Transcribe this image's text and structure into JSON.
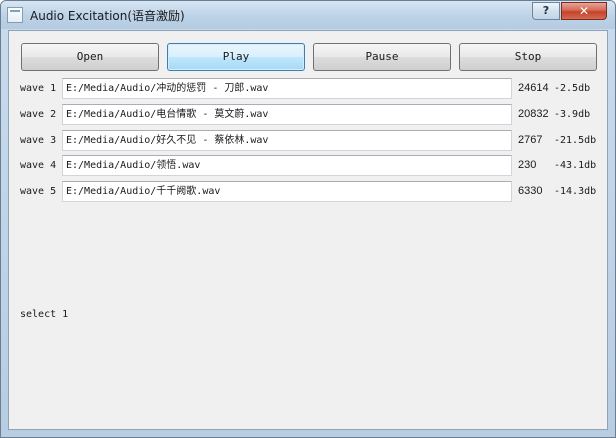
{
  "window": {
    "title": "Audio Excitation(语音激励)",
    "help_label": "?",
    "close_label": "✕"
  },
  "toolbar": {
    "open_label": "Open",
    "play_label": "Play",
    "pause_label": "Pause",
    "stop_label": "Stop"
  },
  "waves": [
    {
      "label": "wave 1",
      "path": "E:/Media/Audio/冲动的惩罚 - 刀郎.wav",
      "value": "24614",
      "db": "-2.5db"
    },
    {
      "label": "wave 2",
      "path": "E:/Media/Audio/电台情歌 - 莫文蔚.wav",
      "value": "20832",
      "db": "-3.9db"
    },
    {
      "label": "wave 3",
      "path": "E:/Media/Audio/好久不见 - 蔡依林.wav",
      "value": "2767",
      "db": "-21.5db"
    },
    {
      "label": "wave 4",
      "path": "E:/Media/Audio/领悟.wav",
      "value": "230",
      "db": "-43.1db"
    },
    {
      "label": "wave 5",
      "path": "E:/Media/Audio/千千阙歌.wav",
      "value": "6330",
      "db": "-14.3db"
    }
  ],
  "status": {
    "text": "select 1"
  },
  "colors": {
    "focus_border": "#3c7fb1",
    "close_red": "#c4432c",
    "client_bg": "#f0f0f0"
  },
  "icons": {
    "app": "app-window-icon",
    "help": "help-icon",
    "close": "close-icon"
  }
}
